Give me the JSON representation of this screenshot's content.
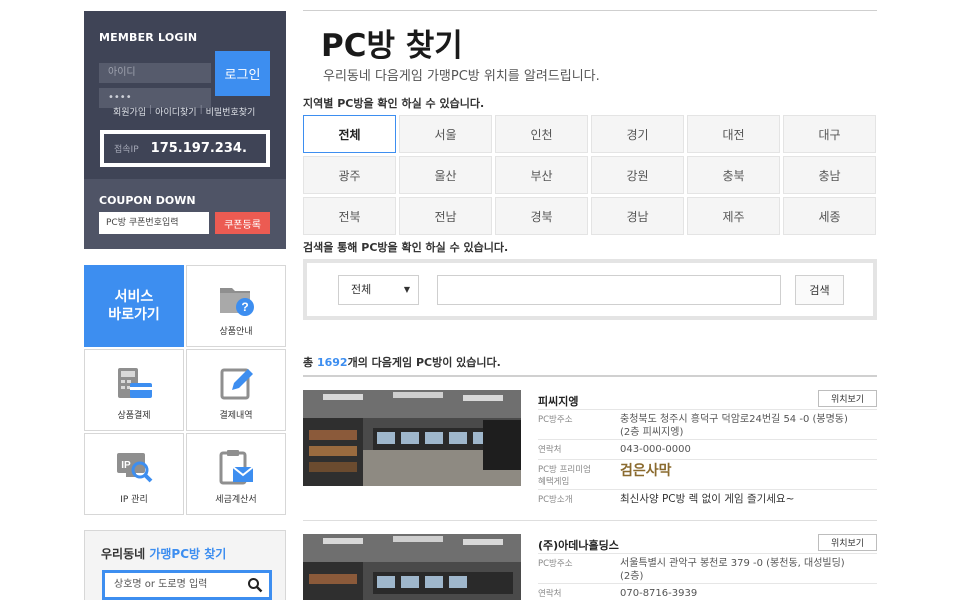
{
  "login": {
    "title": "MEMBER LOGIN",
    "id_placeholder": "아이디",
    "pw_value": "••••",
    "button": "로그인",
    "links": [
      "회원가입",
      "아이디찾기",
      "비밀번호찾기"
    ],
    "ip_label": "접속IP",
    "ip_value": "175.197.234."
  },
  "coupon": {
    "title": "COUPON DOWN",
    "placeholder": "PC방 쿠폰번호입력",
    "button": "쿠폰등록"
  },
  "services": {
    "main_label_1": "서비스",
    "main_label_2": "바로가기",
    "items": [
      {
        "label": "상품안내",
        "icon": "folder-question-icon"
      },
      {
        "label": "상품결제",
        "icon": "calculator-card-icon"
      },
      {
        "label": "결제내역",
        "icon": "pencil-edit-icon"
      },
      {
        "label": "IP 관리",
        "icon": "ip-search-icon"
      },
      {
        "label": "세금계산서",
        "icon": "clipboard-mail-icon"
      }
    ]
  },
  "finder": {
    "title_prefix": "우리동네 ",
    "title_highlight": "가맹PC방 찾기",
    "placeholder": "상호명 or 도로명 입력"
  },
  "main": {
    "title": "PC방 찾기",
    "subtitle": "우리동네 다음게임 가맹PC방 위치를 알려드립니다.",
    "region_label": "지역별 PC방을 확인 하실 수 있습니다.",
    "regions": [
      "전체",
      "서울",
      "인천",
      "경기",
      "대전",
      "대구",
      "광주",
      "울산",
      "부산",
      "강원",
      "충북",
      "충남",
      "전북",
      "전남",
      "경북",
      "경남",
      "제주",
      "세종"
    ],
    "active_region": "전체",
    "search_label": "검색을 통해 PC방을 확인 하실 수 있습니다.",
    "search_select": "전체",
    "search_button": "검색",
    "count_prefix": "총 ",
    "count_value": "1692",
    "count_suffix": "개의 다음게임 PC방이 있습니다."
  },
  "results": [
    {
      "name": "피씨지엥",
      "location_button": "위치보기",
      "address_label": "PC방주소",
      "address_line1": "충청북도 청주시 흥덕구 덕암로24번길 54 -0 (봉명동)",
      "address_line2": "(2층 피씨지엥)",
      "phone_label": "연락처",
      "phone": "043-000-0000",
      "premium_label_1": "PC방 프리미엄",
      "premium_label_2": "혜택게임",
      "premium_game": "검은사막",
      "intro_label": "PC방소개",
      "intro": "최신사양 PC방 렉 없이 게임 즐기세요~"
    },
    {
      "name": "(주)아데나홀딩스",
      "location_button": "위치보기",
      "address_label": "PC방주소",
      "address_line1": "서울특별시 관악구 봉천로 379 -0 (봉천동, 대성빌딩)",
      "address_line2": "(2층)",
      "phone_label": "연락처",
      "phone": "070-8716-3939"
    }
  ],
  "colors": {
    "accent": "#3d8ef0",
    "sidebar_dark": "#3f4456",
    "coupon_red": "#ec5b52"
  }
}
